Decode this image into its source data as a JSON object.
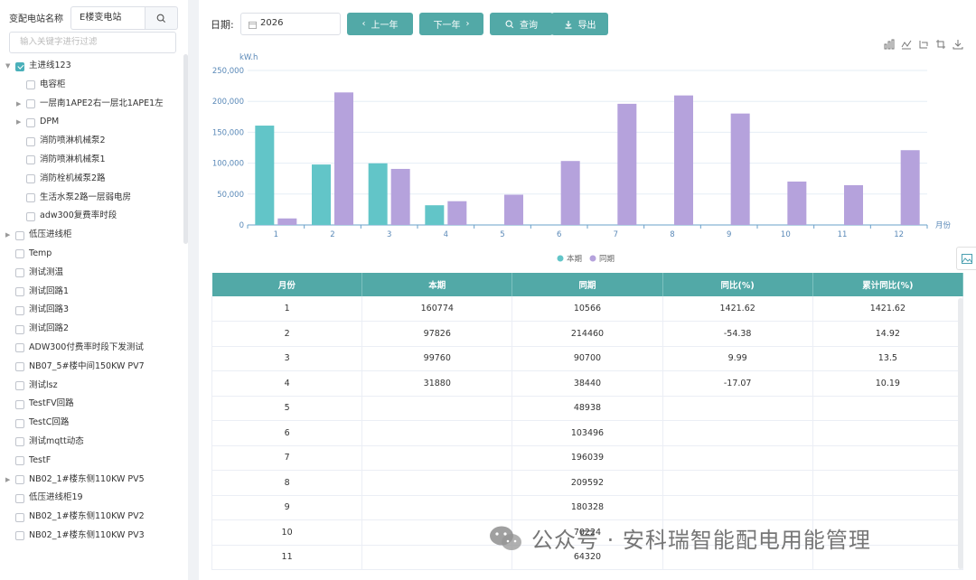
{
  "sidebar": {
    "station_label": "变配电站名称",
    "station_value": "E楼变电站",
    "filter_placeholder": "输入关键字进行过滤",
    "tree": [
      {
        "label": "主进线123",
        "level": 0,
        "arrow": "down",
        "checked": true
      },
      {
        "label": "电容柜",
        "level": 1,
        "arrow": "",
        "checked": false
      },
      {
        "label": "一层南1APE2右一层北1APE1左",
        "level": 1,
        "arrow": "right",
        "checked": false
      },
      {
        "label": "DPM",
        "level": 1,
        "arrow": "right",
        "checked": false
      },
      {
        "label": "消防喷淋机械泵2",
        "level": 1,
        "arrow": "",
        "checked": false
      },
      {
        "label": "消防喷淋机械泵1",
        "level": 1,
        "arrow": "",
        "checked": false
      },
      {
        "label": "消防栓机械泵2路",
        "level": 1,
        "arrow": "",
        "checked": false
      },
      {
        "label": "生活水泵2路一层弱电房",
        "level": 1,
        "arrow": "",
        "checked": false
      },
      {
        "label": "adw300复费率时段",
        "level": 1,
        "arrow": "",
        "checked": false
      },
      {
        "label": "低压进线柜",
        "level": 0,
        "arrow": "right",
        "checked": false
      },
      {
        "label": "Temp",
        "level": 0,
        "arrow": "",
        "checked": false
      },
      {
        "label": "测试测温",
        "level": 0,
        "arrow": "",
        "checked": false
      },
      {
        "label": "测试回路1",
        "level": 0,
        "arrow": "",
        "checked": false
      },
      {
        "label": "测试回路3",
        "level": 0,
        "arrow": "",
        "checked": false
      },
      {
        "label": "测试回路2",
        "level": 0,
        "arrow": "",
        "checked": false
      },
      {
        "label": "ADW300付费率时段下发测试",
        "level": 0,
        "arrow": "",
        "checked": false
      },
      {
        "label": "NB07_5#楼中间150KW PV7",
        "level": 0,
        "arrow": "",
        "checked": false
      },
      {
        "label": "测试lsz",
        "level": 0,
        "arrow": "",
        "checked": false
      },
      {
        "label": "TestFV回路",
        "level": 0,
        "arrow": "",
        "checked": false
      },
      {
        "label": "TestC回路",
        "level": 0,
        "arrow": "",
        "checked": false
      },
      {
        "label": "测试mqtt动态",
        "level": 0,
        "arrow": "",
        "checked": false
      },
      {
        "label": "TestF",
        "level": 0,
        "arrow": "",
        "checked": false
      },
      {
        "label": "NB02_1#楼东侧110KW PV5",
        "level": 0,
        "arrow": "right",
        "checked": false
      },
      {
        "label": "低压进线柜19",
        "level": 0,
        "arrow": "",
        "checked": false
      },
      {
        "label": "NB02_1#楼东侧110KW PV2",
        "level": 0,
        "arrow": "",
        "checked": false
      },
      {
        "label": "NB02_1#楼东侧110KW PV3",
        "level": 0,
        "arrow": "",
        "checked": false
      }
    ]
  },
  "toolbar": {
    "date_label": "日期:",
    "year": "2026",
    "prev_label": "上一年",
    "next_label": "下一年",
    "query_label": "查询",
    "export_label": "导出"
  },
  "chart_data": {
    "type": "bar",
    "ylabel": "kW.h",
    "xlabel": "月份",
    "ylim": [
      0,
      250000
    ],
    "yticks": [
      "250,000",
      "200,000",
      "150,000",
      "100,000",
      "50,000",
      "0"
    ],
    "categories": [
      "1",
      "2",
      "3",
      "4",
      "5",
      "6",
      "7",
      "8",
      "9",
      "10",
      "11",
      "12"
    ],
    "series": [
      {
        "name": "本期",
        "color": "#62c5c8",
        "values": [
          160774,
          97826,
          99760,
          31880,
          null,
          null,
          null,
          null,
          null,
          null,
          null,
          null
        ]
      },
      {
        "name": "同期",
        "color": "#b5a2dc",
        "values": [
          10566,
          214460,
          90700,
          38440,
          48938,
          103496,
          196039,
          209592,
          180328,
          70224,
          64320,
          121000
        ]
      }
    ],
    "legend": "bottom-center",
    "grid": true
  },
  "table": {
    "headers": [
      "月份",
      "本期",
      "同期",
      "同比(%)",
      "累计同比(%)"
    ],
    "rows": [
      [
        "1",
        "160774",
        "10566",
        "1421.62",
        "1421.62"
      ],
      [
        "2",
        "97826",
        "214460",
        "-54.38",
        "14.92"
      ],
      [
        "3",
        "99760",
        "90700",
        "9.99",
        "13.5"
      ],
      [
        "4",
        "31880",
        "38440",
        "-17.07",
        "10.19"
      ],
      [
        "5",
        "",
        "48938",
        "",
        ""
      ],
      [
        "6",
        "",
        "103496",
        "",
        ""
      ],
      [
        "7",
        "",
        "196039",
        "",
        ""
      ],
      [
        "8",
        "",
        "209592",
        "",
        ""
      ],
      [
        "9",
        "",
        "180328",
        "",
        ""
      ],
      [
        "10",
        "",
        "70224",
        "",
        ""
      ],
      [
        "11",
        "",
        "64320",
        "",
        ""
      ]
    ]
  },
  "watermark": {
    "text": "公众号 · 安科瑞智能配电用能管理"
  }
}
